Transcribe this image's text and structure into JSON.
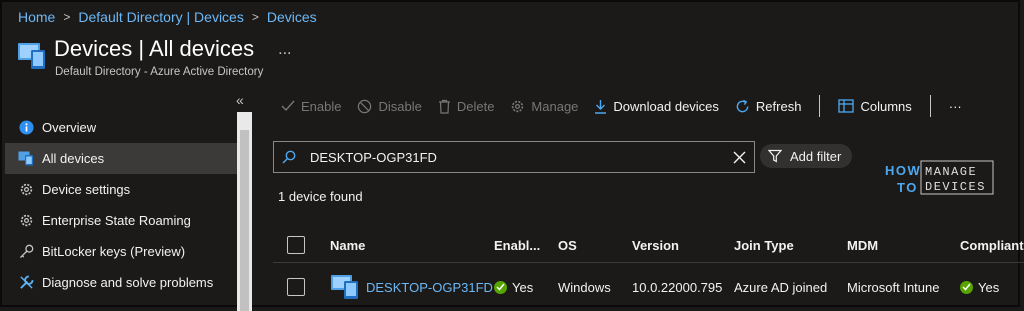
{
  "breadcrumb": [
    "Home",
    "Default Directory | Devices",
    "Devices"
  ],
  "header": {
    "title": "Devices | All devices",
    "subtitle": "Default Directory - Azure Active Directory",
    "more": "..."
  },
  "sidebar": {
    "collapse": "«",
    "items": [
      {
        "label": "Overview",
        "icon": "info-icon"
      },
      {
        "label": "All devices",
        "icon": "devices-icon"
      },
      {
        "label": "Device settings",
        "icon": "gear-icon"
      },
      {
        "label": "Enterprise State Roaming",
        "icon": "gear-icon"
      },
      {
        "label": "BitLocker keys (Preview)",
        "icon": "key-icon"
      },
      {
        "label": "Diagnose and solve problems",
        "icon": "wrench-icon"
      }
    ]
  },
  "toolbar": {
    "enable": "Enable",
    "disable": "Disable",
    "delete": "Delete",
    "manage": "Manage",
    "download": "Download devices",
    "refresh": "Refresh",
    "columns": "Columns",
    "more": "···"
  },
  "search": {
    "value": "DESKTOP-OGP31FD"
  },
  "filter": {
    "label": "Add filter"
  },
  "logo": {
    "line1": "HOW",
    "line2": "TO",
    "word1": "MANAGE",
    "word2": "DEVICES"
  },
  "result_count": "1 device found",
  "table": {
    "columns": [
      "Name",
      "Enabl...",
      "OS",
      "Version",
      "Join Type",
      "MDM",
      "Compliant"
    ],
    "rows": [
      {
        "name": "DESKTOP-OGP31FD",
        "enabled": "Yes",
        "os": "Windows",
        "version": "10.0.22000.795",
        "join_type": "Azure AD joined",
        "mdm": "Microsoft Intune",
        "compliant": "Yes"
      }
    ]
  },
  "colors": {
    "accent": "#6cb8f6",
    "success": "#57a300",
    "background": "#1b1a19"
  }
}
